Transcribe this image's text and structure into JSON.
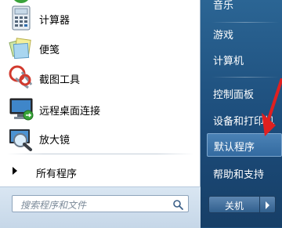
{
  "programs": [
    {
      "label": "计算器",
      "icon": "calculator-icon"
    },
    {
      "label": "便笺",
      "icon": "sticky-notes-icon"
    },
    {
      "label": "截图工具",
      "icon": "snipping-tool-icon"
    },
    {
      "label": "远程桌面连接",
      "icon": "remote-desktop-icon"
    },
    {
      "label": "放大镜",
      "icon": "magnifier-icon"
    }
  ],
  "all_programs": {
    "label": "所有程序",
    "icon": "arrow-right-icon"
  },
  "search": {
    "placeholder": "搜索程序和文件",
    "icon": "search-icon"
  },
  "right_menu": {
    "items": [
      {
        "label": "音乐"
      },
      {
        "label": "游戏"
      },
      {
        "label": "计算机"
      },
      {
        "label": "控制面板"
      },
      {
        "label": "设备和打印机"
      },
      {
        "label": "默认程序",
        "highlighted": true
      },
      {
        "label": "帮助和支持"
      }
    ]
  },
  "shutdown": {
    "label": "关机",
    "icon": "arrow-right-icon"
  },
  "colors": {
    "right_pane": "#1b4a78",
    "highlight": "#3f78ab",
    "annotation_arrow": "#e02020"
  }
}
